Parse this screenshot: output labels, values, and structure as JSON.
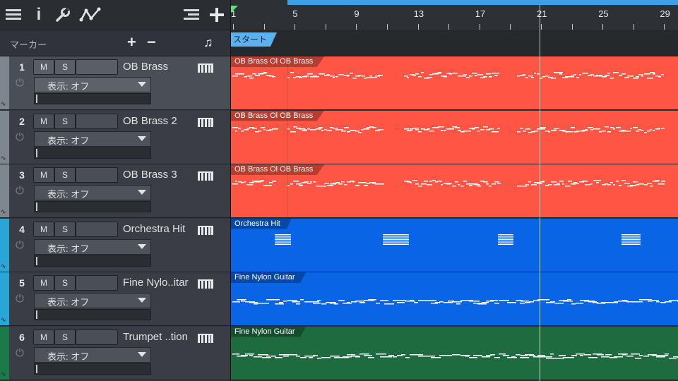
{
  "toolbar": {
    "icons": [
      "menu-icon",
      "info-icon",
      "wrench-icon",
      "automation-icon",
      "list-icon",
      "add-icon"
    ],
    "info_glyph": "i"
  },
  "marker_bar": {
    "label": "マーカー",
    "add": "+",
    "remove": "−",
    "note_glyph": "♫"
  },
  "colors": {
    "brass": "#ff5544",
    "orchestra": "#0a64e6",
    "guitar": "#0a64e6",
    "trumpet": "#1e6b40",
    "ruler_accent": "#3aa0e8"
  },
  "tracks": [
    {
      "number": "1",
      "name": "OB Brass",
      "mute": "M",
      "solo": "S",
      "display": "表示: オフ",
      "strip_color": "#7e8790",
      "selected": true
    },
    {
      "number": "2",
      "name": "OB Brass 2",
      "mute": "M",
      "solo": "S",
      "display": "表示: オフ",
      "strip_color": "#7e8790",
      "selected": false
    },
    {
      "number": "3",
      "name": "OB Brass 3",
      "mute": "M",
      "solo": "S",
      "display": "表示: オフ",
      "strip_color": "#7e8790",
      "selected": false
    },
    {
      "number": "4",
      "name": "Orchestra Hit",
      "mute": "M",
      "solo": "S",
      "display": "表示: オフ",
      "strip_color": "#2aa6d6",
      "selected": false
    },
    {
      "number": "5",
      "name": "Fine Nylo..itar",
      "mute": "M",
      "solo": "S",
      "display": "表示: オフ",
      "strip_color": "#2aa6d6",
      "selected": false
    },
    {
      "number": "6",
      "name": "Trumpet ..tion",
      "mute": "M",
      "solo": "S",
      "display": "表示: オフ",
      "strip_color": "#1a7a4a",
      "selected": false
    }
  ],
  "ruler": {
    "bars": [
      "1",
      "5",
      "9",
      "13",
      "17",
      "21",
      "25",
      "29"
    ]
  },
  "start_marker": "スタート",
  "lanes": [
    {
      "clip_title": "OB Brass Ol OB Brass",
      "color_key": "brass"
    },
    {
      "clip_title": "OB Brass Ol OB Brass",
      "color_key": "brass"
    },
    {
      "clip_title": "OB Brass Ol OB Brass",
      "color_key": "brass"
    },
    {
      "clip_title": "Orchestra Hit",
      "color_key": "orchestra"
    },
    {
      "clip_title": "Fine Nylon Guitar",
      "color_key": "guitar"
    },
    {
      "clip_title": "Fine Nylon Guitar",
      "color_key": "trumpet"
    }
  ]
}
